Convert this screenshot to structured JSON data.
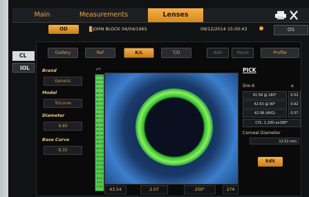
{
  "tabs": {
    "main": "Main",
    "measurements": "Measurements",
    "lenses": "Lenses"
  },
  "patient": {
    "eye_left": "OD",
    "name": "JOHN BLOCK 04/04/1965",
    "datetime": "09/12/2014 15:00:43",
    "eye_right": "OS"
  },
  "side": {
    "cl": "CL",
    "iol": "IOL"
  },
  "toolbar": {
    "gallery": "Gallery",
    "ref": "Ref",
    "kl": "K/L",
    "td": "T/D",
    "add": "Add",
    "reset": "Reset",
    "profile": "Profile"
  },
  "fields": {
    "brand_label": "Brand",
    "brand_value": "Generic",
    "model_label": "Model",
    "model_value": "Tricurve",
    "diameter_label": "Diameter",
    "diameter_value": "9.80",
    "basecurve_label": "Base Curve",
    "basecurve_value": "8.35"
  },
  "map": {
    "unit": "μm",
    "scale_values": [
      "104.00",
      "100.00",
      "96.00",
      "92.00",
      "88.00",
      "84.00",
      "80.00",
      "76.00",
      "72.00",
      "68.00",
      "64.00",
      "60.00",
      "56.00",
      "52.00",
      "48.00",
      "44.00",
      "40.00",
      "36.00",
      "32.00",
      "28.00",
      "24.00",
      "20.00",
      "16.00",
      "12.00",
      "8.00",
      "4.00",
      "0.00"
    ],
    "readouts": {
      "a": "43.54",
      "b": "2.07",
      "c": "259°",
      "d": "274"
    }
  },
  "pick": {
    "title": "PICK",
    "simk_label": "Sim-K",
    "e_label": "e",
    "rows": [
      {
        "k": "41.58 @ 180°",
        "e": "0.52"
      },
      {
        "k": "42.63 @ 90°",
        "e": "0.62"
      },
      {
        "k": "42.08 (AVG)",
        "e": "0.57"
      }
    ],
    "cyl": "CYL: 1.10D ax180°",
    "corneal_label": "Corneal Diameter",
    "corneal_value": "12.52 mm",
    "edit": "Edit"
  },
  "colors": {
    "accent": "#f3b04a",
    "text_accent": "#e7a64a"
  },
  "icons": [
    "print-icon",
    "close-icon",
    "caret-icon",
    "clock-icon"
  ]
}
